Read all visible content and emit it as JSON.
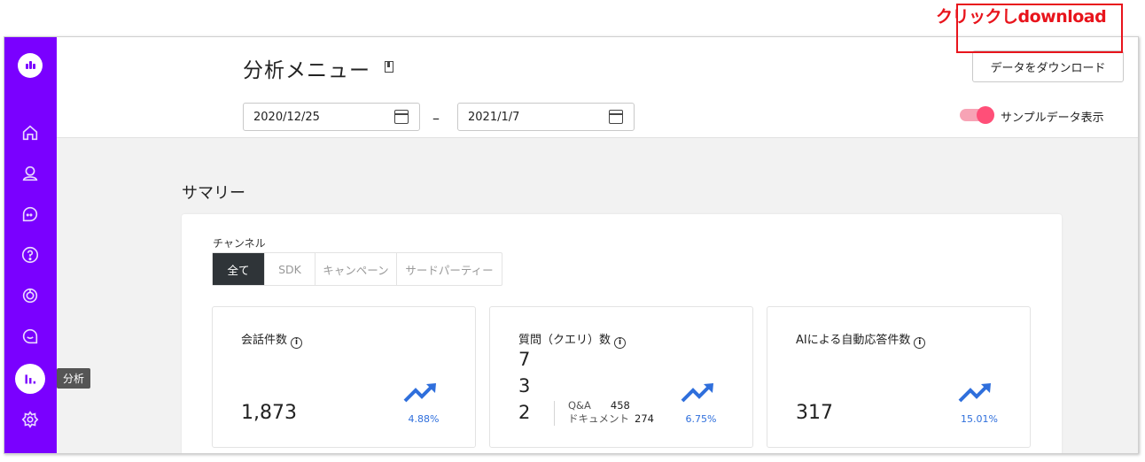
{
  "annotation": {
    "text": "クリックしdownload",
    "color": "#e8141c"
  },
  "sidebar": {
    "accent": "#7a00ff",
    "items": [
      {
        "icon": "home-icon"
      },
      {
        "icon": "user-icon"
      },
      {
        "icon": "chat-icon"
      },
      {
        "icon": "help-icon"
      },
      {
        "icon": "target-icon"
      },
      {
        "icon": "message-icon"
      },
      {
        "icon": "analytics-icon",
        "active": true
      },
      {
        "icon": "gear-icon"
      }
    ],
    "tooltip": "分析"
  },
  "header": {
    "title": "分析メニュー",
    "download_label": "データをダウンロード",
    "date_start": "2020/12/25",
    "date_separator": "–",
    "date_end": "2021/1/7",
    "sample_toggle_label": "サンプルデータ表示",
    "sample_toggle_on": true
  },
  "summary": {
    "title": "サマリー",
    "channel_label": "チャンネル",
    "tabs": [
      {
        "label": "全て",
        "active": true
      },
      {
        "label": "SDK"
      },
      {
        "label": "キャンペーン"
      },
      {
        "label": "サードパーティー"
      }
    ],
    "metrics": [
      {
        "title": "会話件数",
        "value": "1,873",
        "trend": "4.88%"
      },
      {
        "title": "質問（クエリ）数",
        "digits": [
          "7",
          "3",
          "2"
        ],
        "trend": "6.75%",
        "breakdown": [
          {
            "label": "Q&A",
            "value": "458"
          },
          {
            "label": "ドキュメント",
            "value": "274"
          }
        ]
      },
      {
        "title": "AIによる自動応答件数",
        "value": "317",
        "trend": "15.01%"
      }
    ],
    "trend_color": "#2f6fdc"
  }
}
